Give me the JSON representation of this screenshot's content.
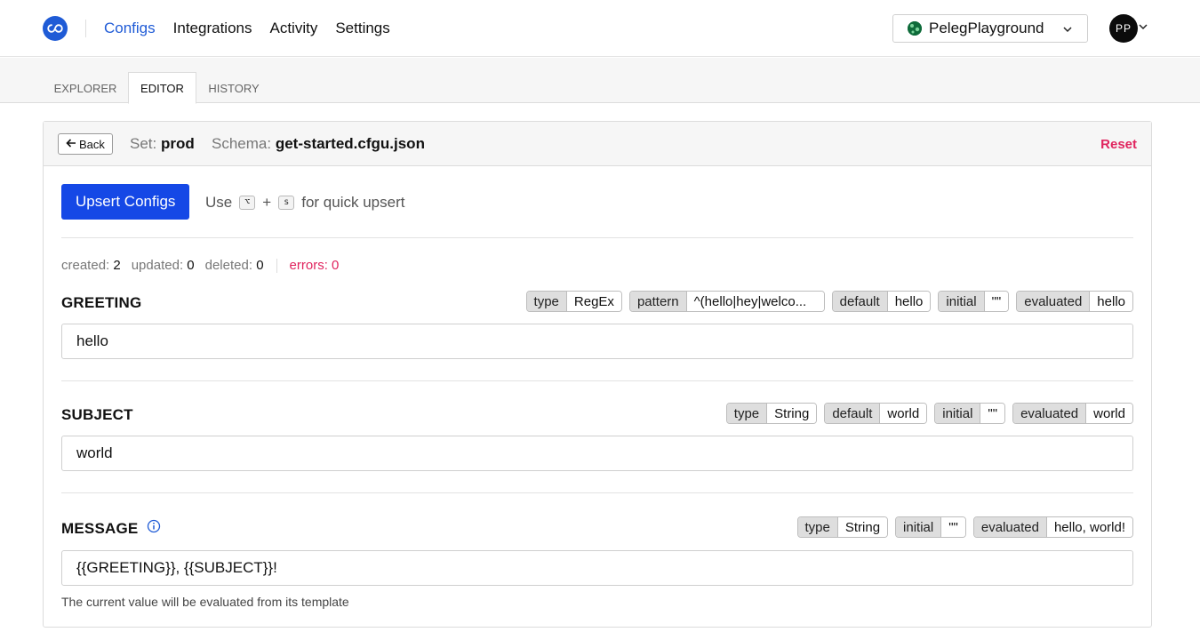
{
  "header": {
    "nav": [
      "Configs",
      "Integrations",
      "Activity",
      "Settings"
    ],
    "active_nav": "Configs",
    "project_name": "PelegPlayground",
    "avatar_initials": "PP"
  },
  "tabs": [
    "EXPLORER",
    "EDITOR",
    "HISTORY"
  ],
  "active_tab": "EDITOR",
  "editor": {
    "back_label": "Back",
    "set_label": "Set:",
    "set_value": "prod",
    "schema_label": "Schema:",
    "schema_value": "get-started.cfgu.json",
    "reset_label": "Reset",
    "upsert_label": "Upsert Configs",
    "hint_use": "Use",
    "hint_key1": "⌥",
    "hint_plus": "+",
    "hint_key2": "s",
    "hint_rest": "for quick upsert"
  },
  "stats": {
    "created_label": "created:",
    "created": "2",
    "updated_label": "updated:",
    "updated": "0",
    "deleted_label": "deleted:",
    "deleted": "0",
    "errors_label": "errors:",
    "errors": "0"
  },
  "fields": {
    "greeting": {
      "name": "GREETING",
      "value": "hello",
      "chips": {
        "type_k": "type",
        "type_v": "RegEx",
        "pattern_k": "pattern",
        "pattern_v": "^(hello|hey|welco...",
        "default_k": "default",
        "default_v": "hello",
        "initial_k": "initial",
        "initial_v": "\"\"",
        "evaluated_k": "evaluated",
        "evaluated_v": "hello"
      }
    },
    "subject": {
      "name": "SUBJECT",
      "value": "world",
      "chips": {
        "type_k": "type",
        "type_v": "String",
        "default_k": "default",
        "default_v": "world",
        "initial_k": "initial",
        "initial_v": "\"\"",
        "evaluated_k": "evaluated",
        "evaluated_v": "world"
      }
    },
    "message": {
      "name": "MESSAGE",
      "value": "{{GREETING}}, {{SUBJECT}}!",
      "helper": "The current value will be evaluated from its template",
      "chips": {
        "type_k": "type",
        "type_v": "String",
        "initial_k": "initial",
        "initial_v": "\"\"",
        "evaluated_k": "evaluated",
        "evaluated_v": "hello, world!"
      }
    }
  },
  "colors": {
    "accent": "#1f5bd6",
    "button": "#1548e6",
    "danger": "#e0245e"
  },
  "icons": [
    "logo-icon",
    "globe-icon",
    "chevron-down-icon",
    "arrow-left-icon",
    "info-icon"
  ]
}
